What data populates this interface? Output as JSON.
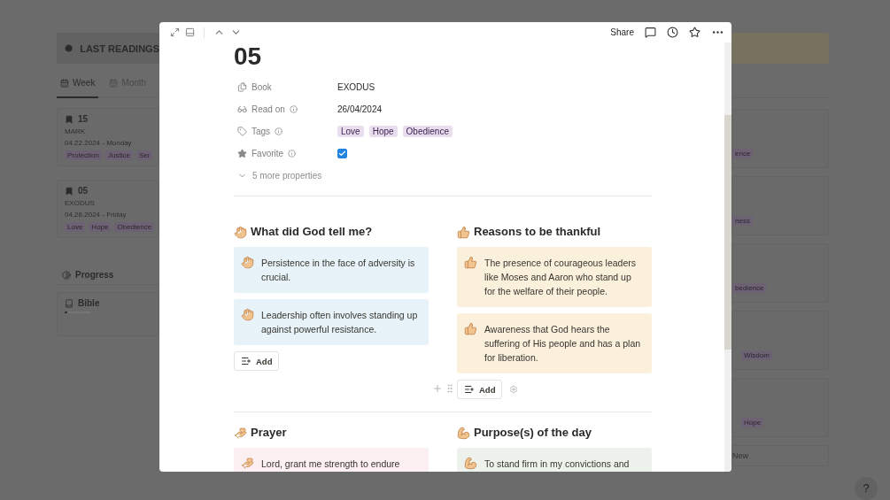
{
  "board": {
    "title": "LAST READINGS",
    "tabs": [
      {
        "label": "Week",
        "selected": true
      },
      {
        "label": "Month",
        "selected": false
      }
    ],
    "cards": [
      {
        "title": "15",
        "book": "MARK",
        "date": "04.22.2024 - Monday",
        "tags": [
          "Protection",
          "Justice",
          "Ser"
        ]
      },
      {
        "title": "05",
        "book": "EXODUS",
        "date": "04.26.2024 - Friday",
        "tags": [
          "Love",
          "Hope",
          "Obedience"
        ]
      }
    ],
    "progress": {
      "title": "Progress",
      "item": {
        "name": "Bible",
        "level": 0.1
      }
    },
    "right_cards": [
      {
        "tags": [
          "ence"
        ]
      },
      {
        "tags": [
          "ness"
        ]
      },
      {
        "tags": [
          "bedience"
        ]
      },
      {
        "tags": [
          "Wisdom"
        ]
      },
      {
        "tags": [
          "Hope"
        ]
      }
    ],
    "new_label": "New",
    "help": "?"
  },
  "page": {
    "share": "Share",
    "title": "05",
    "properties": [
      {
        "kind": "text",
        "label": "Book",
        "info": false,
        "value": "EXODUS"
      },
      {
        "kind": "text",
        "label": "Read on",
        "info": true,
        "value": "26/04/2024"
      },
      {
        "kind": "tags",
        "label": "Tags",
        "info": true,
        "tags": [
          "Love",
          "Hope",
          "Obedience"
        ]
      },
      {
        "kind": "checkbox",
        "label": "Favorite",
        "info": true,
        "checked": true
      }
    ],
    "more_properties": "5 more properties",
    "rows": [
      [
        {
          "heading": "What did God tell me?",
          "color": "#e7f3f8",
          "hover": false,
          "items": [
            "Persistence in the face of adversity is crucial.",
            "Leadership often involves standing up against powerful resistance."
          ],
          "add": "Add"
        },
        {
          "heading": "Reasons to be thankful",
          "color": "#fbf0dc",
          "hover": true,
          "items": [
            "The presence of courageous leaders like Moses and Aaron who stand up for the welfare of their people.",
            "Awareness that God hears the suffering of His people and has a plan for liberation."
          ],
          "add": "Add"
        }
      ],
      [
        {
          "heading": "Prayer",
          "color": "#fbeff1",
          "items": [
            "Lord, grant me strength to endure"
          ]
        },
        {
          "heading": "Purpose(s) of the day",
          "color": "#edf3ec",
          "items": [
            "To stand firm in my convictions and"
          ]
        }
      ]
    ]
  }
}
